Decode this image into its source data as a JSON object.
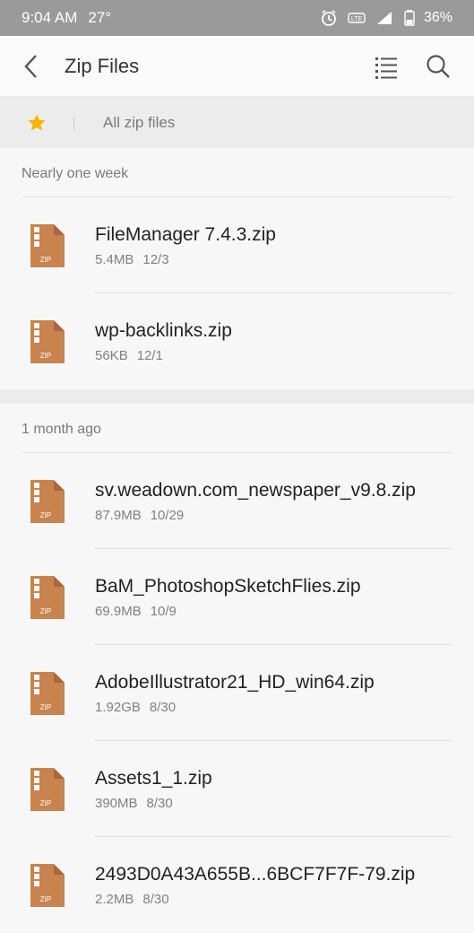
{
  "status": {
    "time": "9:04 AM",
    "temp": "27°",
    "battery": "36%",
    "network_label": "VoLTE"
  },
  "appbar": {
    "title": "Zip Files",
    "icons": [
      "back-arrow",
      "list-view",
      "search"
    ]
  },
  "breadcrumb": {
    "label": "All zip files",
    "star_color": "#f6b400"
  },
  "sections": [
    {
      "header": "Nearly one week",
      "files": [
        {
          "name": "FileManager 7.4.3.zip",
          "size": "5.4MB",
          "date": "12/3"
        },
        {
          "name": "wp-backlinks.zip",
          "size": "56KB",
          "date": "12/1"
        }
      ]
    },
    {
      "header": "1 month ago",
      "files": [
        {
          "name": "sv.weadown.com_newspaper_v9.8.zip",
          "size": "87.9MB",
          "date": "10/29"
        },
        {
          "name": "BaM_PhotoshopSketchFlies.zip",
          "size": "69.9MB",
          "date": "10/9"
        },
        {
          "name": "AdobeIllustrator21_HD_win64.zip",
          "size": "1.92GB",
          "date": "8/30"
        },
        {
          "name": "Assets1_1.zip",
          "size": "390MB",
          "date": "8/30"
        },
        {
          "name": "2493D0A43A655B...6BCF7F7F-79.zip",
          "size": "2.2MB",
          "date": "8/30"
        }
      ]
    }
  ],
  "zip_label": "ZIP",
  "colors": {
    "zip_icon": "#c8834f",
    "accent_star": "#f6b400"
  }
}
